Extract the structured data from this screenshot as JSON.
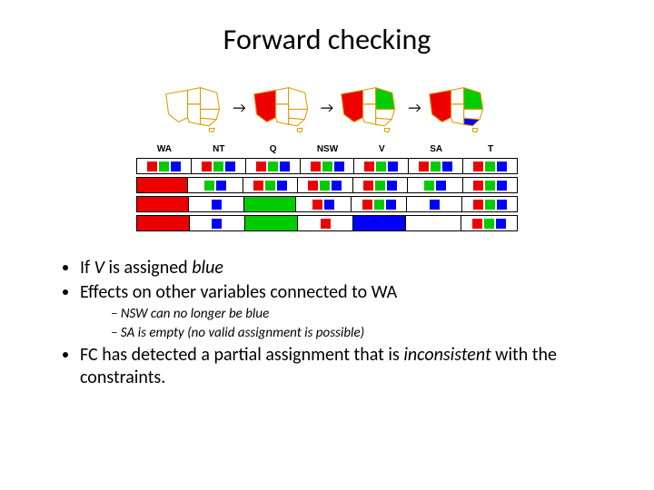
{
  "title": "Forward checking",
  "vars": [
    "WA",
    "NT",
    "Q",
    "NSW",
    "V",
    "SA",
    "T"
  ],
  "rows": [
    [
      [
        "r",
        "g",
        "b"
      ],
      [
        "r",
        "g",
        "b"
      ],
      [
        "r",
        "g",
        "b"
      ],
      [
        "r",
        "g",
        "b"
      ],
      [
        "r",
        "g",
        "b"
      ],
      [
        "r",
        "g",
        "b"
      ],
      [
        "r",
        "g",
        "b"
      ]
    ],
    [
      [
        "R"
      ],
      [
        "g",
        "b"
      ],
      [
        "r",
        "g",
        "b"
      ],
      [
        "r",
        "g",
        "b"
      ],
      [
        "r",
        "g",
        "b"
      ],
      [
        "g",
        "b"
      ],
      [
        "r",
        "g",
        "b"
      ]
    ],
    [
      [
        "R"
      ],
      [
        "b"
      ],
      [
        "G"
      ],
      [
        "r",
        "b"
      ],
      [
        "r",
        "g",
        "b"
      ],
      [
        "b"
      ],
      [
        "r",
        "g",
        "b"
      ]
    ],
    [
      [
        "R"
      ],
      [
        "b"
      ],
      [
        "G"
      ],
      [
        "r"
      ],
      [
        "B"
      ],
      [],
      [
        "r",
        "g",
        "b"
      ]
    ]
  ],
  "maps": [
    {
      "wa": "#fff",
      "nt": "#fff",
      "q": "#fff",
      "nsw": "#fff",
      "v": "#fff",
      "sa": "#fff",
      "t": "#fff"
    },
    {
      "wa": "#e00",
      "nt": "#fff",
      "q": "#fff",
      "nsw": "#fff",
      "v": "#fff",
      "sa": "#fff",
      "t": "#fff"
    },
    {
      "wa": "#e00",
      "nt": "#fff",
      "q": "#0c0",
      "nsw": "#fff",
      "v": "#fff",
      "sa": "#fff",
      "t": "#fff"
    },
    {
      "wa": "#e00",
      "nt": "#fff",
      "q": "#0c0",
      "nsw": "#fff",
      "v": "#00f",
      "sa": "#fff",
      "t": "#fff"
    }
  ],
  "bullets": [
    {
      "pre": "If ",
      "ital": "V",
      "post": " is assigned ",
      "ital2": "blue"
    },
    {
      "text": "Effects on other variables connected to WA",
      "sub": [
        "NSW can no longer be blue",
        "SA is empty (no valid assignment is possible)"
      ]
    },
    {
      "pre": "FC has detected a partial assignment that is ",
      "ital": "inconsistent",
      "post": " with the constraints."
    }
  ]
}
